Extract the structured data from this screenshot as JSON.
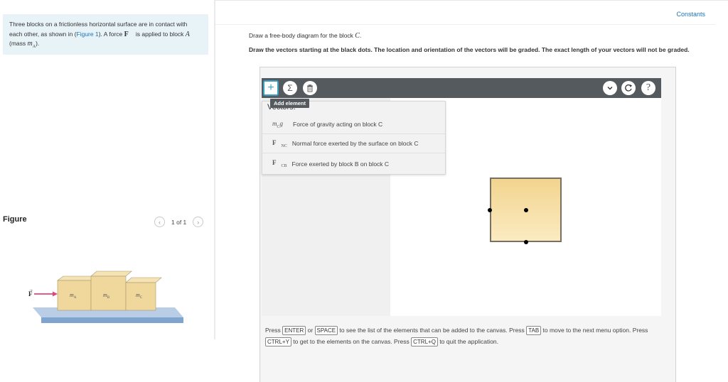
{
  "problem": {
    "text_1": "Three blocks on a frictionless horizontal surface are in contact with each other, as shown in (",
    "figure_link": "Figure 1",
    "text_2": "). A force ",
    "force_symbol": "F",
    "text_3": " is applied to block ",
    "block_symbol": "A",
    "text_4": " (mass ",
    "mass_symbol": "mA",
    "text_5": ")."
  },
  "figure": {
    "title": "Figure",
    "page": "1 of 1",
    "prev_icon": "chevron-left",
    "next_icon": "chevron-right",
    "force_label": "F",
    "block_labels": [
      "mA",
      "mB",
      "mC"
    ]
  },
  "header": {
    "constants_label": "Constants"
  },
  "instructions": {
    "line1_prefix": "Draw a free-body diagram for the block ",
    "line1_symbol": "C",
    "line1_suffix": ".",
    "line2": "Draw the vectors starting at the black dots. The location and orientation of the vectors will be graded. The exact length of your vectors will not be graded."
  },
  "toolbar": {
    "add_icon": "plus",
    "sum_icon": "sigma",
    "trash_icon": "trash",
    "chevron_icon": "chevron-down",
    "reset_icon": "reset",
    "help_icon": "question",
    "tooltip": "Add element"
  },
  "dropdown": {
    "header": "Vectors:",
    "items": [
      {
        "symbol": "mcg",
        "label": "Force of gravity acting on block C"
      },
      {
        "symbol": "FNC",
        "label": "Normal force exerted by the surface on block C"
      },
      {
        "symbol": "FCB",
        "label": "Force exerted by block B on block C"
      }
    ]
  },
  "help": {
    "press": "Press",
    "enter": "ENTER",
    "or": "or",
    "space": "SPACE",
    "t1": "to see the list of the elements that can be added to the canvas. Press",
    "tab": "TAB",
    "t2": "to move to the next menu option. Press",
    "ctrly": "CTRL+Y",
    "t3": "to get to the elements on the canvas. Press",
    "ctrlq": "CTRL+Q",
    "t4": "to quit the application."
  },
  "colors": {
    "accent": "#1a73b8",
    "toolbar": "#555a5f",
    "block_fill": "#f2d48e",
    "force_arrow": "#e0457b",
    "problem_bg": "#e8f3f8"
  }
}
